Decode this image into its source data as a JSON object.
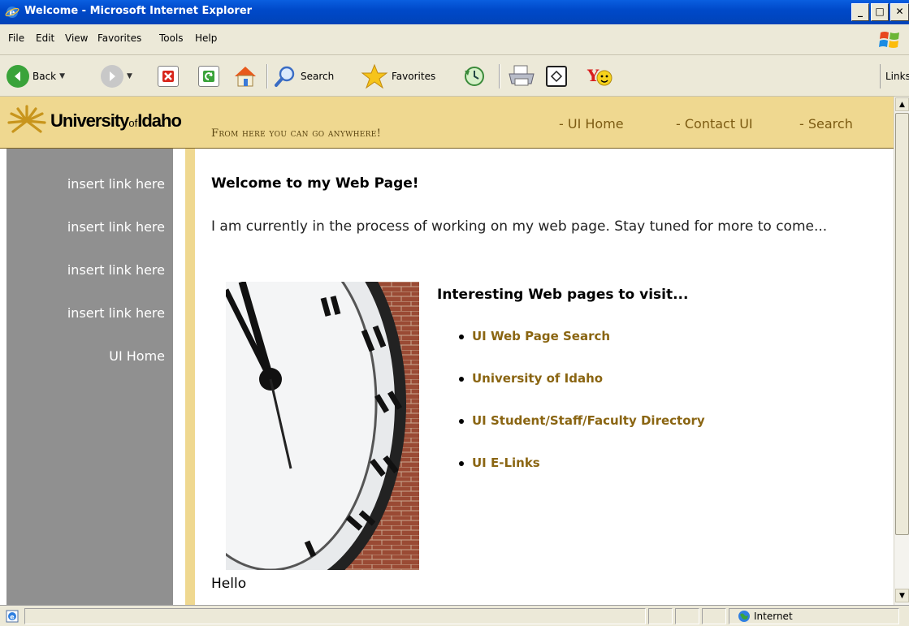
{
  "window": {
    "title": "Welcome - Microsoft Internet Explorer",
    "min": "_",
    "max": "□",
    "close": "✕"
  },
  "menu": [
    "File",
    "Edit",
    "View",
    "Favorites",
    "Tools",
    "Help"
  ],
  "toolbar": {
    "back_label": "Back",
    "search_label": "Search",
    "favorites_label": "Favorites",
    "links_label": "Links"
  },
  "header": {
    "logo_main": "University",
    "logo_of": "of",
    "logo_end": "Idaho",
    "tagline": "From here you can go anywhere!",
    "nav": [
      "- UI Home",
      "- Contact UI",
      "- Search"
    ]
  },
  "sidebar": {
    "links": [
      "insert link here",
      "insert link here",
      "insert link here",
      "insert link here",
      "UI Home"
    ]
  },
  "content": {
    "welcome": "Welcome to my Web Page!",
    "intro": "I am currently in the process of working on my web page.  Stay tuned for more to come...",
    "interesting": "Interesting Web pages to visit...",
    "links": [
      "UI Web Page Search",
      "University of Idaho",
      "UI Student/Staff/Faculty Directory",
      "UI E-Links"
    ],
    "hello": "Hello"
  },
  "status": {
    "zone": "Internet"
  },
  "colors": {
    "header_gold": "#efd890",
    "link_gold": "#8a6512",
    "sidebar_gray": "#909090"
  },
  "icons": [
    "ie-icon",
    "windows-flag-icon",
    "back-arrow-icon",
    "forward-arrow-icon",
    "stop-icon",
    "refresh-icon",
    "home-icon",
    "search-magnifier-icon",
    "favorites-star-icon",
    "history-icon",
    "print-icon",
    "edit-icon",
    "yahoo-icon",
    "globe-icon"
  ]
}
